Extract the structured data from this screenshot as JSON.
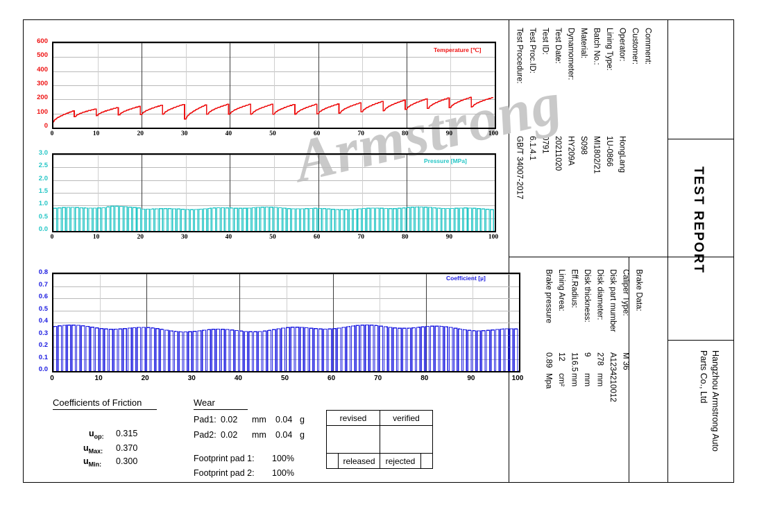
{
  "watermark": "Armstrong",
  "report": {
    "title": "TEST REPORT",
    "company": "Hangzhou Armstrong Auto\nParts Co., Ltd",
    "company_line1": "Hangzhou Armstrong Auto",
    "company_line2": "Parts Co., Ltd"
  },
  "test_info": {
    "fields": [
      {
        "label": "Test Procedure:",
        "value": "GB/T 34007-2017"
      },
      {
        "label": "Test Proc.ID:",
        "value": "6.1.4.1"
      },
      {
        "label": "Test ID:",
        "value": "0791"
      },
      {
        "label": "Test Date:",
        "value": "20211020"
      },
      {
        "label": "Dynamometer:",
        "value": "HY209A"
      },
      {
        "label": "Material:",
        "value": "S098"
      },
      {
        "label": "Batch No.:",
        "value": "MI1802/21"
      },
      {
        "label": "Lining Type:",
        "value": "1U-0866"
      },
      {
        "label": "Operator:",
        "value": "HongLang"
      },
      {
        "label": "Customer:",
        "value": ""
      },
      {
        "label": "Comment:",
        "value": ""
      }
    ]
  },
  "brake_data": {
    "heading": "Brake Data:",
    "fields": [
      {
        "label": "Caliper Type:",
        "value": "M 36",
        "unit": ""
      },
      {
        "label": "Disk part mumber",
        "value": "A1234210012",
        "unit": ""
      },
      {
        "label": "Disk diameter:",
        "value": "278",
        "unit": "mm"
      },
      {
        "label": "Disk thickness:",
        "value": "9",
        "unit": "mm"
      },
      {
        "label": "Eff.Radius:",
        "value": "116.5",
        "unit": "mm"
      },
      {
        "label": "Lining Area:",
        "value": "12",
        "unit": "cm²"
      },
      {
        "label": "Brake pressure",
        "value": "0.89",
        "unit": "Mpa"
      }
    ]
  },
  "friction": {
    "heading": "Coefficients of Friction",
    "rows": [
      {
        "label": "u",
        "sub": "op",
        "colon": ":",
        "value": "0.315"
      },
      {
        "label": "u",
        "sub": "Max",
        "colon": ":",
        "value": "0.370"
      },
      {
        "label": "u",
        "sub": "Min",
        "colon": ":",
        "value": "0.300"
      }
    ]
  },
  "wear": {
    "heading": "Wear",
    "pads": [
      {
        "label": "Pad1:",
        "thickness": "0.02",
        "thickness_unit": "mm",
        "mass": "0.04",
        "mass_unit": "g"
      },
      {
        "label": "Pad2:",
        "thickness": "0.02",
        "thickness_unit": "mm",
        "mass": "0.04",
        "mass_unit": "g"
      }
    ],
    "footprints": [
      {
        "label": "Footprint pad 1:",
        "value": "100%"
      },
      {
        "label": "Footprint pad 2:",
        "value": "100%"
      }
    ]
  },
  "approval": {
    "row1": [
      "revised",
      "verified"
    ],
    "row3": [
      "",
      "released",
      "rejected",
      ""
    ]
  },
  "chart_data": [
    {
      "type": "line",
      "name": "temperature",
      "legend": "Temperature [℃]",
      "color": "#ee1111",
      "ylabel": "",
      "xlabel": "",
      "ylim": [
        0,
        600
      ],
      "yticks": [
        0,
        100,
        200,
        300,
        400,
        500,
        600
      ],
      "xlim": [
        0,
        100
      ],
      "xticks": [
        0,
        10,
        20,
        30,
        40,
        50,
        60,
        70,
        80,
        90,
        100
      ],
      "grid": true,
      "cycles": 20,
      "cycle_peaks": [
        120,
        133,
        143,
        152,
        160,
        166,
        163,
        167,
        167,
        167,
        166,
        167,
        169,
        177,
        187,
        196,
        205,
        212,
        216,
        214
      ],
      "cycle_starts": [
        40,
        78,
        86,
        90,
        93,
        96,
        60,
        95,
        96,
        96,
        95,
        96,
        98,
        104,
        112,
        121,
        129,
        136,
        142,
        148
      ],
      "description": "Sawtooth: each of 20 brake cycles heats from ~95°C to ~165-215°C then cools abruptly"
    },
    {
      "type": "line",
      "name": "pressure",
      "legend": "Pressure [MPa]",
      "color": "#25c6c6",
      "ylabel": "",
      "xlabel": "",
      "ylim": [
        0,
        3.0
      ],
      "yticks": [
        "0.0",
        "0.5",
        "1.0",
        "1.5",
        "2.0",
        "2.5",
        "3.0"
      ],
      "xlim": [
        0,
        100
      ],
      "xticks": [
        0,
        10,
        20,
        30,
        40,
        50,
        60,
        70,
        80,
        90,
        100
      ],
      "grid": true,
      "pulses": 100,
      "pulse_level": 0.89,
      "description": "Square pulse train, each brake application holds ~0.89 MPa then returns to 0"
    },
    {
      "type": "line",
      "name": "coefficient",
      "legend": "Coefficient [µ]",
      "color": "#1b1be0",
      "ylabel": "",
      "xlabel": "",
      "ylim": [
        0,
        0.8
      ],
      "yticks": [
        "0.0",
        "0.1",
        "0.2",
        "0.3",
        "0.4",
        "0.5",
        "0.6",
        "0.7",
        "0.8"
      ],
      "xlim": [
        0,
        100
      ],
      "xticks": [
        0,
        10,
        20,
        30,
        40,
        50,
        60,
        70,
        80,
        90,
        100
      ],
      "grid": true,
      "pulses": 100,
      "pulse_level": 0.35,
      "u_op": 0.315,
      "u_max": 0.37,
      "u_min": 0.3,
      "description": "Square pulse train of friction coefficient, plateau ~0.33-0.37"
    }
  ]
}
